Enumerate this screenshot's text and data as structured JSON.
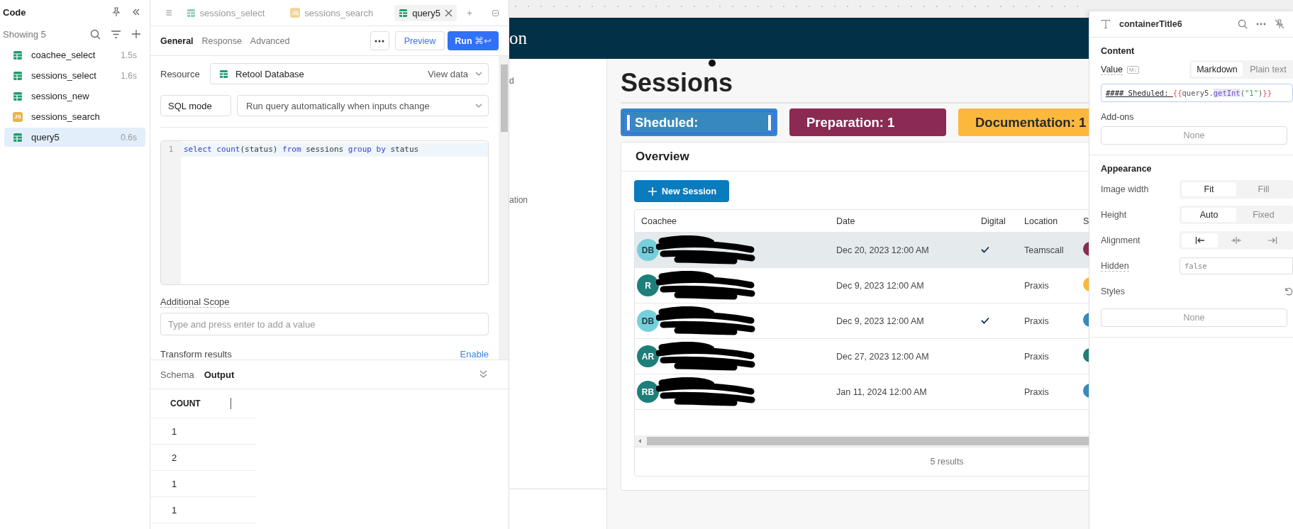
{
  "code_panel": {
    "title": "Code",
    "count_label": "Showing 5",
    "items": [
      {
        "name": "coachee_select",
        "kind": "table",
        "time": "1.5s",
        "selected": false
      },
      {
        "name": "sessions_select",
        "kind": "table",
        "time": "1.6s",
        "selected": false
      },
      {
        "name": "sessions_new",
        "kind": "table",
        "selected": false
      },
      {
        "name": "sessions_search",
        "kind": "js",
        "badge": "JS",
        "selected": false
      },
      {
        "name": "query5",
        "kind": "table",
        "time": "0.6s",
        "selected": true
      }
    ]
  },
  "editor": {
    "tabs": [
      {
        "label": "sessions_select",
        "kind": "table",
        "selected": false
      },
      {
        "label": "sessions_search",
        "kind": "js",
        "badge": "JS",
        "selected": false
      },
      {
        "label": "query5",
        "kind": "table",
        "selected": true
      }
    ],
    "sections": [
      {
        "label": "General",
        "selected": true
      },
      {
        "label": "Response",
        "selected": false
      },
      {
        "label": "Advanced",
        "selected": false
      }
    ],
    "preview_button": "Preview",
    "run_button": {
      "label": "Run",
      "shortcut": "⌘↩"
    },
    "resource": {
      "label": "Resource",
      "value": "Retool Database",
      "action": "View data"
    },
    "mode": "SQL mode",
    "trigger": "Run query automatically when inputs change",
    "code_lines": [
      {
        "number": "1",
        "tokens": [
          {
            "text": "select ",
            "kind": "keyword"
          },
          {
            "text": "count",
            "kind": "keyword"
          },
          {
            "text": "(status) ",
            "kind": "plain"
          },
          {
            "text": "from",
            "kind": "keyword"
          },
          {
            "text": " sessions ",
            "kind": "plain"
          },
          {
            "text": "group ",
            "kind": "keyword"
          },
          {
            "text": "by",
            "kind": "keyword"
          },
          {
            "text": " status",
            "kind": "plain"
          }
        ]
      }
    ],
    "additional_scope": {
      "label": "Additional Scope",
      "placeholder": "Type and press enter to add a value"
    },
    "transform": {
      "label": "Transform results",
      "action": "Enable"
    },
    "output": {
      "tabs": [
        {
          "label": "Schema",
          "selected": false
        },
        {
          "label": "Output",
          "selected": true
        }
      ],
      "column": "COUNT",
      "rows": [
        "1",
        "2",
        "1",
        "1"
      ]
    }
  },
  "canvas": {
    "header_title": "on",
    "nav_fragments": [
      "d",
      "ation"
    ],
    "page_title": "Sessions",
    "stat_cards": [
      {
        "label": "Sheduled:",
        "color": "#3789bd",
        "selected": true
      },
      {
        "label": "Preparation: 1",
        "color": "#8b2a52",
        "selected": false
      },
      {
        "label": "Documentation: 1",
        "color": "#fbb83d",
        "selected": false
      }
    ],
    "overview": {
      "title": "Overview",
      "new_button": "New Session",
      "columns": [
        "Coachee",
        "Date",
        "Digital",
        "Location",
        "S"
      ],
      "rows": [
        {
          "avatar": {
            "initials": "DB",
            "color": "#76d0dc"
          },
          "date": "Dec 20, 2023 12:00 AM",
          "digital": true,
          "location": "Teamscall",
          "status": {
            "color": "#8b2a52"
          },
          "selected": true
        },
        {
          "avatar": {
            "initials": "R",
            "color": "#1e7f7a"
          },
          "date": "Dec 9, 2023 12:00 AM",
          "digital": false,
          "location": "Praxis",
          "status": {
            "color": "#fbb83d"
          },
          "selected": false
        },
        {
          "avatar": {
            "initials": "DB",
            "color": "#76d0dc"
          },
          "date": "Dec 9, 2023 12:00 AM",
          "digital": true,
          "location": "Praxis",
          "status": {
            "color": "#3789bd"
          },
          "selected": false
        },
        {
          "avatar": {
            "initials": "AR",
            "color": "#1e7f7a"
          },
          "date": "Dec 27, 2023 12:00 AM",
          "digital": false,
          "location": "Praxis",
          "status": {
            "color": "#1e7f7a"
          },
          "selected": false
        },
        {
          "avatar": {
            "initials": "RB",
            "color": "#1e7f7a"
          },
          "date": "Jan 11, 2024 12:00 AM",
          "digital": false,
          "location": "Praxis",
          "status": {
            "color": "#3789bd"
          },
          "selected": false
        }
      ],
      "footer": "5 results"
    }
  },
  "inspector": {
    "title": "containerTitle6",
    "content_heading": "Content",
    "value_label": "Value",
    "value_badge": "M↓",
    "format_options": [
      {
        "label": "Markdown",
        "selected": true
      },
      {
        "label": "Plain text",
        "selected": false
      }
    ],
    "value_tokens": [
      {
        "text": "#### Sheduled: ",
        "kind": "markdown"
      },
      {
        "text": "{{",
        "kind": "brace"
      },
      {
        "text": "query5",
        "kind": "ident"
      },
      {
        "text": ".",
        "kind": "ident"
      },
      {
        "text": "getInt",
        "kind": "method"
      },
      {
        "text": "(",
        "kind": "ident"
      },
      {
        "text": "\"1\"",
        "kind": "string"
      },
      {
        "text": ")",
        "kind": "ident"
      },
      {
        "text": "}}",
        "kind": "brace"
      }
    ],
    "addons": {
      "label": "Add-ons",
      "placeholder": "None"
    },
    "appearance_heading": "Appearance",
    "image_width": {
      "label": "Image width",
      "options": [
        {
          "label": "Fit",
          "selected": true
        },
        {
          "label": "Fill",
          "selected": false
        }
      ]
    },
    "height": {
      "label": "Height",
      "options": [
        {
          "label": "Auto",
          "selected": true
        },
        {
          "label": "Fixed",
          "selected": false
        }
      ]
    },
    "alignment": {
      "label": "Alignment",
      "options": [
        {
          "kind": "left",
          "selected": true
        },
        {
          "kind": "center",
          "selected": false
        },
        {
          "kind": "right",
          "selected": false
        }
      ]
    },
    "hidden": {
      "label": "Hidden",
      "value": "false"
    },
    "styles": {
      "label": "Styles",
      "placeholder": "None"
    }
  }
}
